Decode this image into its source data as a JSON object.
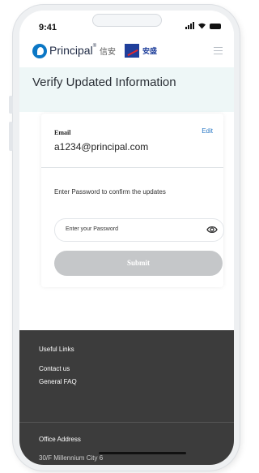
{
  "status_bar": {
    "time": "9:41"
  },
  "header": {
    "brand": "Principal",
    "brand_chinese": "信安",
    "partner": "安盛"
  },
  "page": {
    "title": "Verify Updated Information"
  },
  "card": {
    "email_label": "Email",
    "edit_label": "Edit",
    "email_value": "a1234@principal.com",
    "prompt": "Enter Password to confirm the updates",
    "password_placeholder": "Enter your Password",
    "submit_label": "Submit"
  },
  "footer": {
    "useful_links_heading": "Useful Links",
    "links": [
      "Contact us",
      "General FAQ"
    ],
    "office_heading": "Office Address",
    "office_line": "30/F Millennium City 6"
  },
  "colors": {
    "brand_blue": "#0b77c5",
    "title_band": "#eef7f7",
    "submit_disabled": "#c5c7c9",
    "footer_bg": "#3c3c3c",
    "link_blue": "#2a78c5"
  },
  "icons": [
    "signal-icon",
    "wifi-icon",
    "battery-icon",
    "menu-icon",
    "eye-icon"
  ]
}
